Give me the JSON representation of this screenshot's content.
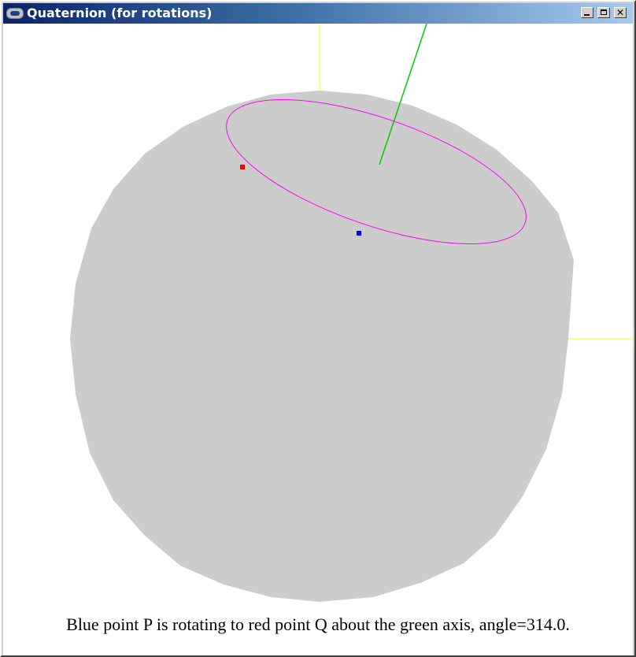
{
  "window": {
    "title": "Quaternion (for rotations)",
    "controls": {
      "minimize": "minimize",
      "maximize": "maximize",
      "close": "close"
    }
  },
  "scene": {
    "caption": "Blue point P is rotating to red point Q about the green axis, angle=314.0.",
    "colors": {
      "background": "#ffffff",
      "sphere": "#cccccc",
      "axes": "#ffff00",
      "rotation_axis": "#00cc00",
      "orbit": "#ff00ff",
      "point_p": "#0000ff",
      "point_q": "#ff0000"
    },
    "icons": {
      "app": "app-icon"
    }
  }
}
